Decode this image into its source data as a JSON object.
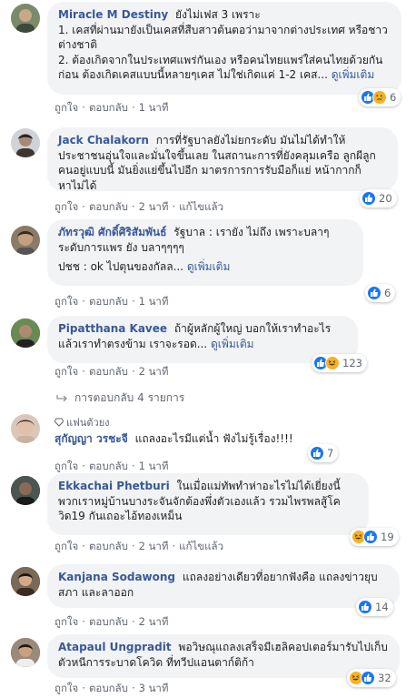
{
  "actions": {
    "like": "ถูกใจ",
    "reply": "ตอบกลับ",
    "dot": "·",
    "edited": "แก้ไขแล้ว"
  },
  "see_more": "ดูเพิ่มเติม",
  "comments": [
    {
      "name": "Miracle M Destiny",
      "text_inline": "ยังไม่เฟส 3 เพราะ",
      "paragraphs": [
        "1. เคสที่ผ่านมายังเป็นเคสที่สืบสาวต้นตอว่ามาจากต่างประเทศ หรือชาวต่างชาติ",
        "2. ต้องเกิดจากในประเทศแพร่กันเอง หรือคนไทยแพร่ใส่คนไทยด้วยกันก่อน ต้องเกิดเคสแบบนี้หลายๆเคส ไม่ใช่เกิดแค่ 1-2 เคส..."
      ],
      "time": "1 นาที",
      "reactions": [
        "like",
        "sad"
      ],
      "count": "6",
      "avatar_color": "#7b8a6a"
    },
    {
      "name": "Jack Chalakorn",
      "text_inline": "การที่รัฐบาลยังไม่ยกระดับ มันไม่ได้ทำให้ประชาชนอุ่นใจและมั่นใจขึ้นเลย ในสถานะการที่ยังคลุมเครือ ลูกผีลูกคนอยู่แบบนี้ มันยิ่งแย่ขึ้นไปอีก มาตรการการรับมือก็แย่ หน้ากากก็หาไม่ได้",
      "time": "2 นาที",
      "edited": true,
      "reactions": [
        "like"
      ],
      "count": "20",
      "avatar_color": "#5a4a45"
    },
    {
      "name": "ภัทรวุฒิ ศักดิ์ศิริสัมพันธ์",
      "text_inline": "รัฐบาล : เรายัง ไม่ถึง เพราะบลาๆระดับการแพร ยัง บลาๆๆๆๆ",
      "paragraphs": [
        "ปชช : ok ไปตุนของกัลล..."
      ],
      "time": "1 นาที",
      "reactions": [
        "like"
      ],
      "count": "6",
      "avatar_color": "#6b5b4b"
    },
    {
      "name": "Pipatthana Kavee",
      "text_inline": "ถ้าผู้หลักผู้ใหญ่ บอกให้เราทำอะไร แล้วเราทำตรงข้าม เราจะรอด...",
      "time": "2 นาที",
      "reactions": [
        "like",
        "haha"
      ],
      "count": "123",
      "avatar_color": "#3f5a3a",
      "replies": "การตอบกลับ 4 รายการ"
    },
    {
      "fan_badge": "แฟนตัวยง",
      "name": "สุกัญญา วรชะจี",
      "text_inline": "แถลงอะไรมีแต่น้ำ ฟังไม่รู้เรื่อง!!!!",
      "time": "1 นาที",
      "reactions": [
        "like"
      ],
      "count": "7",
      "avatar_color": "#a0887a"
    },
    {
      "name": "Ekkachai Phetburi",
      "text_inline": "ในเมื่อแม่ทัพทำห่าอะไรไม่ได้เยี่ยงนี้ พวกเราหมู่บ้านบางระจันจักต้องพึ่งตัวเองแล้ว รวมไพรพลสู้โควิด19 กันเถอะไอ้ทองเหม็น",
      "time": "2 นาที",
      "edited": true,
      "reactions": [
        "haha",
        "like"
      ],
      "count": "19",
      "avatar_color": "#2f3a3a"
    },
    {
      "name": "Kanjana Sodawong",
      "text_inline": "แถลงอย่างเดียวที่อยากฟังคือ แถลงข่าวยุบสภา และลาออก",
      "time": "2 นาที",
      "reactions": [
        "like"
      ],
      "count": "14",
      "avatar_color": "#4a3a30"
    },
    {
      "name": "Atapaul Ungpradit",
      "text_inline": "พอวิษณุแถลงเสร็จมีเฮลิคอปเตอร์มารับไปเก็บตัวหนีการระบาดโควิด ที่ทวีปแอนตาก์ติก้า",
      "time": "3 นาที",
      "reactions": [
        "haha",
        "like"
      ],
      "count": "32",
      "avatar_color": "#5b4634"
    }
  ]
}
